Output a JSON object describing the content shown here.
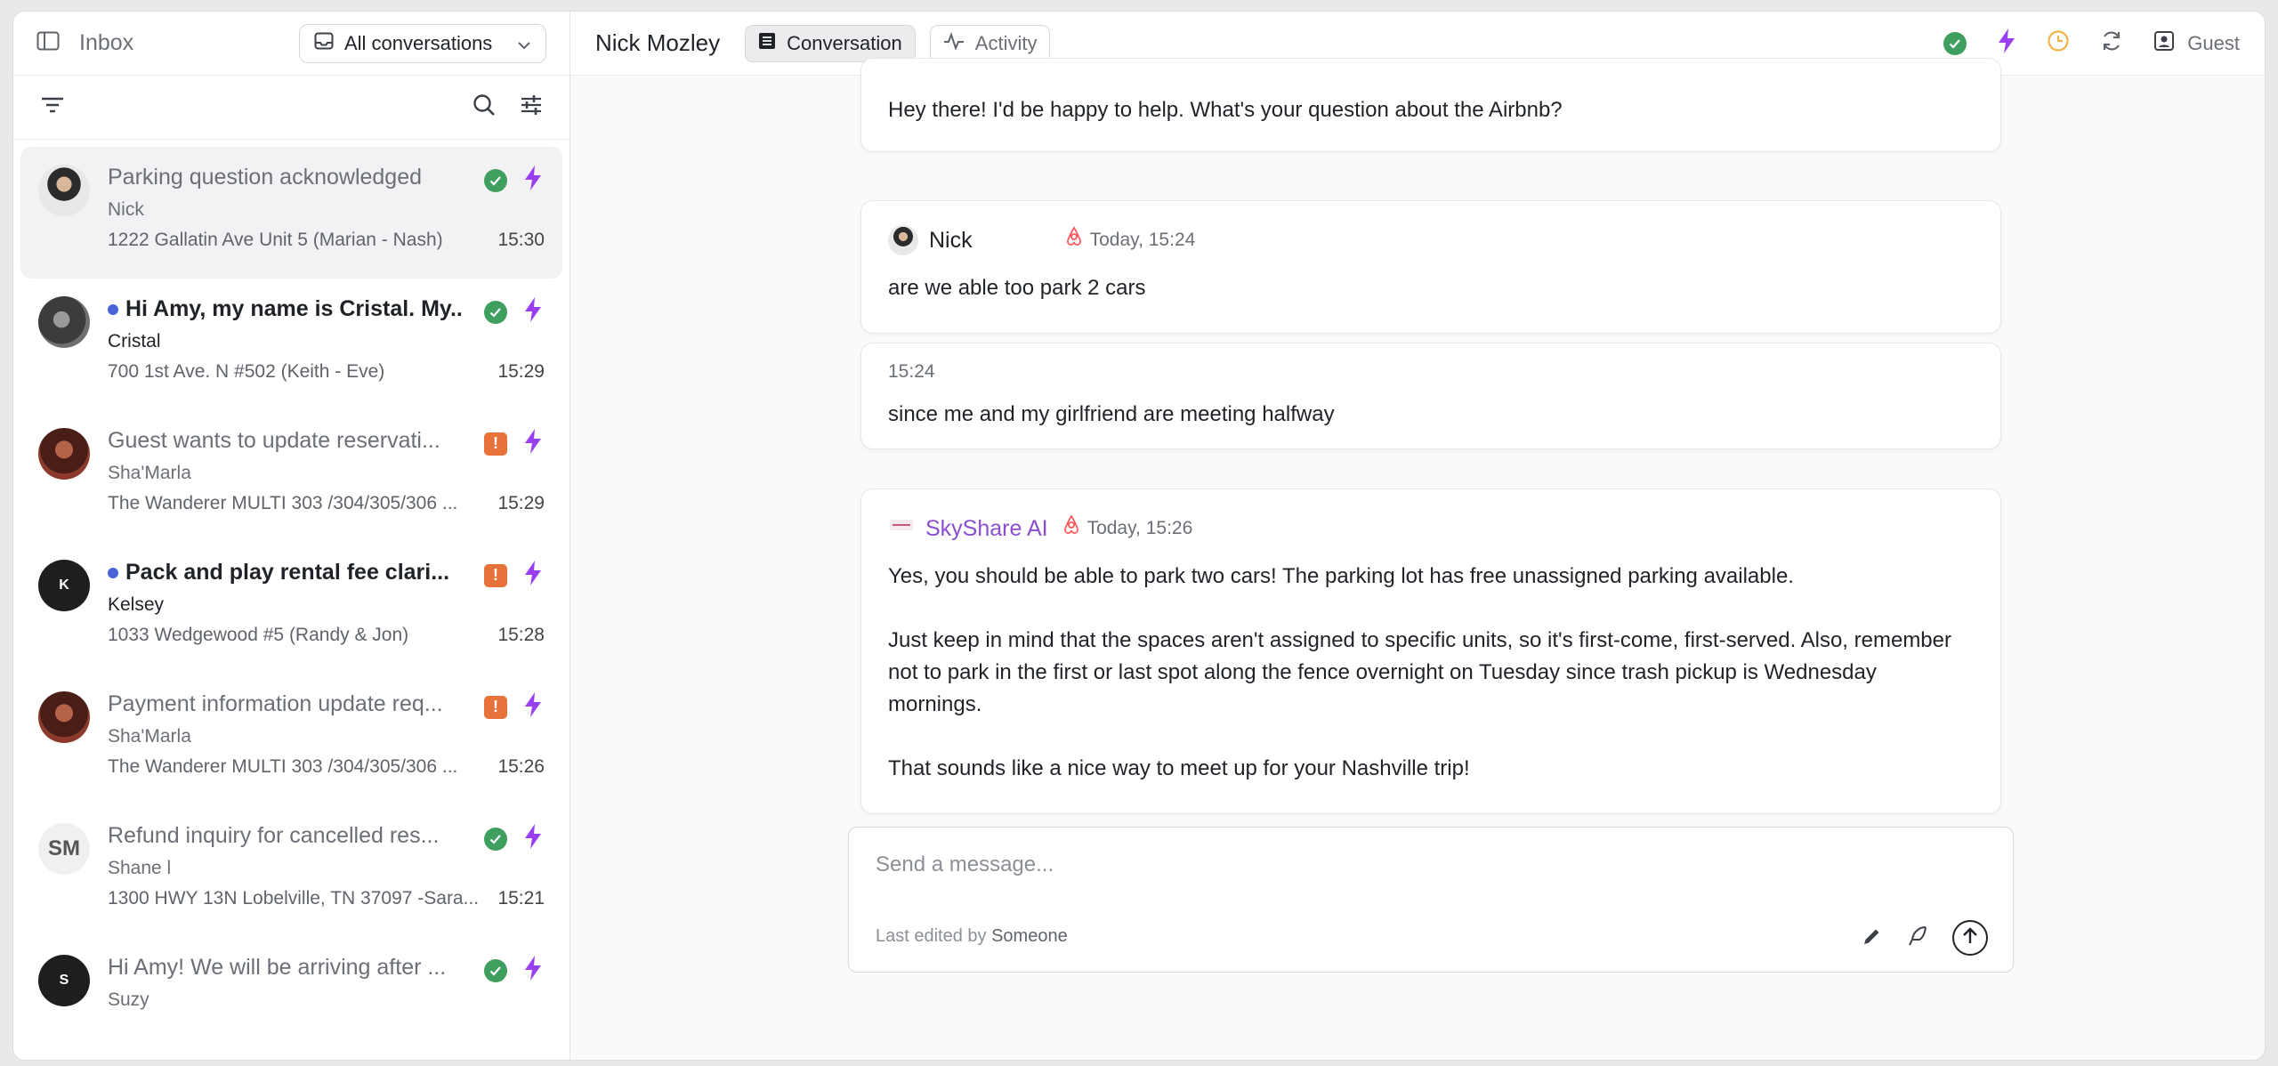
{
  "sidebar": {
    "title": "Inbox",
    "filter_select": "All conversations",
    "conversations": [
      {
        "title": "Parking question acknowledged",
        "name": "Nick",
        "address": "1222 Gallatin Ave Unit 5 (Marian - Nash)",
        "time": "15:30",
        "status": "ok"
      },
      {
        "title": "Hi Amy, my name is Cristal. My...",
        "name": "Cristal",
        "address": "700 1st Ave. N #502 (Keith - Eve)",
        "time": "15:29",
        "status": "ok"
      },
      {
        "title": "Guest wants to update reservati...",
        "name": "Sha'Marla",
        "address": "The Wanderer MULTI 303 /304/305/306 ...",
        "time": "15:29",
        "status": "warn",
        "warn_glyph": "!"
      },
      {
        "title": "Pack and play rental fee clari...",
        "name": "Kelsey",
        "address": "1033 Wedgewood #5 (Randy & Jon)",
        "time": "15:28",
        "status": "warn",
        "warn_glyph": "!",
        "initial": "K"
      },
      {
        "title": "Payment information update req...",
        "name": "Sha'Marla",
        "address": "The Wanderer MULTI 303 /304/305/306 ...",
        "time": "15:26",
        "status": "warn",
        "warn_glyph": "!"
      },
      {
        "title": "Refund inquiry for cancelled res...",
        "name": "Shane l",
        "address": "1300 HWY 13N Lobelville, TN 37097 -Sara...",
        "time": "15:21",
        "status": "ok",
        "initial": "SM"
      },
      {
        "title": "Hi Amy! We will be arriving after ...",
        "name": "Suzy",
        "address": "",
        "time": "",
        "status": "ok",
        "initial": "S"
      }
    ]
  },
  "topbar": {
    "guest_name": "Nick Mozley",
    "tab_conversation": "Conversation",
    "tab_activity": "Activity",
    "guest_label": "Guest"
  },
  "messages": {
    "first": "Hey there! I'd be happy to help. What's your question about the Airbnb?",
    "nick_sender": "Nick",
    "nick_time": "Today, 15:24",
    "nick_msg1": "are we able too park 2 cars",
    "nick_time2": "15:24",
    "nick_msg2": "since me and my girlfriend are meeting halfway",
    "ai_sender": "SkyShare AI",
    "ai_time": "Today, 15:26",
    "ai_p1": "Yes, you should be able to park two cars! The parking lot has free unassigned parking available.",
    "ai_p2": "Just keep in mind that the spaces aren't assigned to specific units, so it's first-come, first-served. Also, remember not to park in the first or last spot along the fence overnight on Tuesday since trash pickup is Wednesday mornings.",
    "ai_p3": "That sounds like a nice way to meet up for your Nashville trip!"
  },
  "composer": {
    "placeholder": "Send a message...",
    "edited_prefix": "Last edited by",
    "edited_by": "Someone"
  },
  "colors": {
    "ok": "#3f9f5f",
    "warn": "#e8733a",
    "bolt": "#9a3ff0",
    "ai": "#8a4fd0",
    "clock": "#f0b44a",
    "unread_dot": "#4a63d9"
  }
}
